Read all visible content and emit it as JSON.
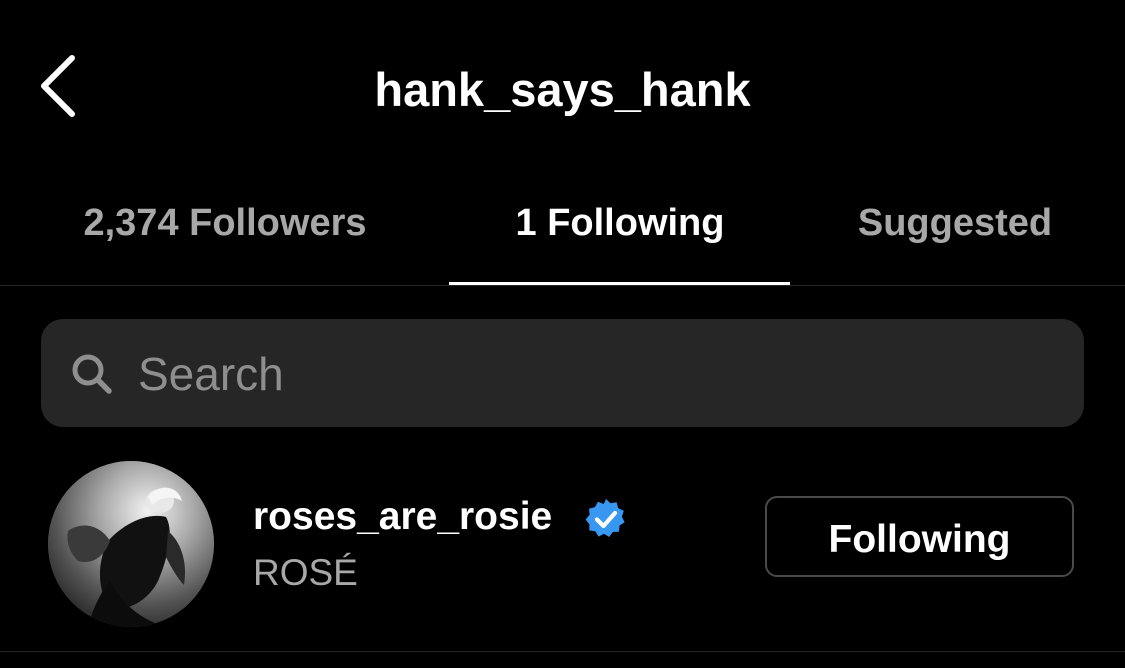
{
  "header": {
    "title": "hank_says_hank",
    "back_icon": "chevron-left-icon"
  },
  "tabs": [
    {
      "label": "2,374 Followers",
      "active": false
    },
    {
      "label": "1 Following",
      "active": true
    },
    {
      "label": "Suggested",
      "active": false
    }
  ],
  "search": {
    "placeholder": "Search",
    "value": "",
    "icon": "search-icon"
  },
  "following_list": [
    {
      "username": "roses_are_rosie",
      "full_name": "ROSÉ",
      "verified": true,
      "button_label": "Following"
    }
  ],
  "colors": {
    "background": "#000000",
    "text_primary": "#ffffff",
    "text_secondary": "#a8a8a8",
    "search_bg": "#262626",
    "verified_badge": "#3897f0",
    "button_border": "#4a4a4a"
  }
}
